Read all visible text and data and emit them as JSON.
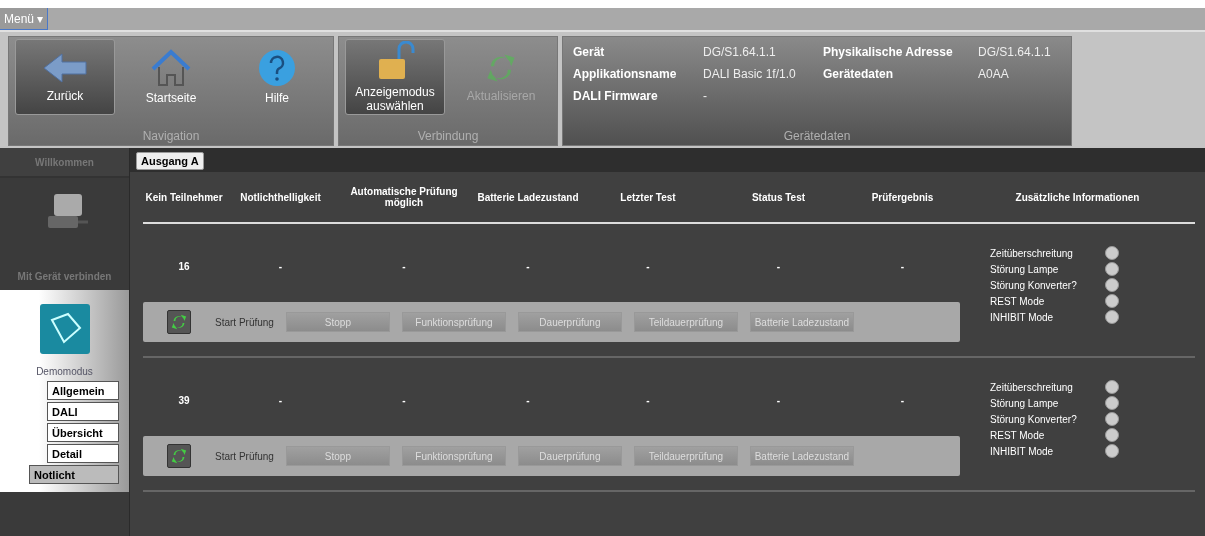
{
  "menu": {
    "label": "Menü ▾"
  },
  "ribbon": {
    "groups": [
      {
        "title": "Navigation",
        "buttons": [
          {
            "kind": "back",
            "label": "Zurück",
            "selected": true,
            "disabled": false
          },
          {
            "kind": "home",
            "label": "Startseite",
            "selected": false,
            "disabled": false
          },
          {
            "kind": "help",
            "label": "Hilfe",
            "selected": false,
            "disabled": false
          }
        ]
      },
      {
        "title": "Verbindung",
        "buttons": [
          {
            "kind": "lock",
            "label": "Anzeigemodus auswählen",
            "selected": true,
            "disabled": false
          },
          {
            "kind": "refresh",
            "label": "Aktualisieren",
            "selected": false,
            "disabled": true
          }
        ]
      }
    ],
    "device": {
      "title": "Gerätedaten",
      "rows": [
        {
          "label": "Gerät",
          "value": "DG/S1.64.1.1",
          "label2": "Physikalische Adresse",
          "value2": "DG/S1.64.1.1"
        },
        {
          "label": "Applikationsname",
          "value": "DALI Basic 1f/1.0",
          "label2": "Gerätedaten",
          "value2": "A0AA"
        },
        {
          "label": "DALI Firmware",
          "value": "-"
        }
      ]
    }
  },
  "sidebar": {
    "header": "Willkommen",
    "connect": "Mit Gerät verbinden",
    "mode": "Demomodus",
    "items": [
      {
        "label": "Allgemein",
        "selected": false
      },
      {
        "label": "DALI",
        "selected": false
      },
      {
        "label": "Übersicht",
        "selected": false
      },
      {
        "label": "Detail",
        "selected": false
      },
      {
        "label": "Notlicht",
        "selected": true
      }
    ]
  },
  "tabs": [
    {
      "label": "Ausgang A",
      "selected": true
    }
  ],
  "table": {
    "columns": [
      "Kein Teilnehmer",
      "Notlichthelligkeit",
      "Automatische Prüfung möglich",
      "Batterie Ladezustand",
      "Letzter Test",
      "Status Test",
      "Prüfergebnis",
      "Zusätzliche Informationen"
    ],
    "rows": [
      {
        "cells": [
          "16",
          "-",
          "-",
          "-",
          "-",
          "-",
          "-"
        ],
        "start": "Start Prüfung",
        "actions": [
          {
            "label": "Stopp",
            "disabled": true
          },
          {
            "label": "Funktionsprüfung",
            "disabled": true
          },
          {
            "label": "Dauerprüfung",
            "disabled": true
          },
          {
            "label": "Teildauerprüfung",
            "disabled": true
          },
          {
            "label": "Batterie Ladezustand",
            "disabled": true
          }
        ],
        "info": [
          {
            "label": "Zeitüberschreitung",
            "on": false
          },
          {
            "label": "Störung Lampe",
            "on": false
          },
          {
            "label": "Störung Konverter?",
            "on": false
          },
          {
            "label": "REST Mode",
            "on": false
          },
          {
            "label": "INHIBIT Mode",
            "on": false
          }
        ]
      },
      {
        "cells": [
          "39",
          "-",
          "-",
          "-",
          "-",
          "-",
          "-"
        ],
        "start": "Start Prüfung",
        "actions": [
          {
            "label": "Stopp",
            "disabled": true
          },
          {
            "label": "Funktionsprüfung",
            "disabled": true
          },
          {
            "label": "Dauerprüfung",
            "disabled": true
          },
          {
            "label": "Teildauerprüfung",
            "disabled": true
          },
          {
            "label": "Batterie Ladezustand",
            "disabled": true
          }
        ],
        "info": [
          {
            "label": "Zeitüberschreitung",
            "on": false
          },
          {
            "label": "Störung Lampe",
            "on": false
          },
          {
            "label": "Störung Konverter?",
            "on": false
          },
          {
            "label": "REST Mode",
            "on": false
          },
          {
            "label": "INHIBIT Mode",
            "on": false
          }
        ]
      }
    ]
  }
}
